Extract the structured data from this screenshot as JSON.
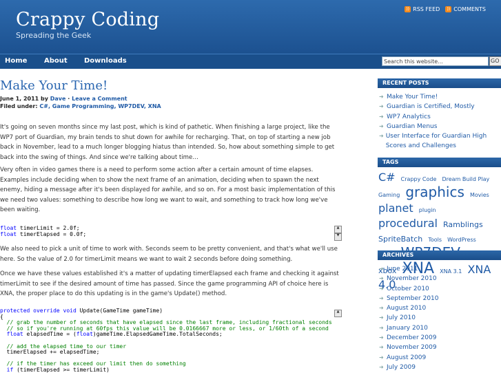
{
  "header": {
    "title": "Crappy Coding",
    "tagline": "Spreading the Geek",
    "feeds": [
      {
        "label": "RSS FEED"
      },
      {
        "label": "COMMENTS"
      }
    ]
  },
  "nav": {
    "items": [
      "Home",
      "About",
      "Downloads"
    ],
    "search_placeholder": "Search this website...",
    "go_label": "GO"
  },
  "post": {
    "title": "Make Your Time!",
    "date_by": "June 1, 2011 by",
    "author": "Dave",
    "sep": "·",
    "comment_link": "Leave a Comment",
    "filed_label": "Filed under:",
    "categories": "C#, Game Programming, WP7DEV, XNA",
    "para1": "It's going on seven months since my last post, which is kind of pathetic. When finishing a large project, like the WP7 port of Guardian, my brain tends to shut down for awhile for recharging. That, on top of starting a new job back in November, lead to a much longer blogging hiatus than intended. So, how about something simple to get back into the swing of things. And since we're talking about time…",
    "para2": "Very often in video games there is a need to perform some action after a certain amount of time elapses. Examples include deciding when to show the next frame of an animation, deciding when to spawn the next enemy, hiding a message after it's been displayed for awhile, and so on. For a most basic implementation of this we need two values: something to describe how long we want to wait, and something to track how long we've been waiting.",
    "para3": "We also need to pick a unit of time to work with. Seconds seem to be pretty convenient, and that's what we'll use here. So the value of 2.0 for timerLimit means we want to wait 2 seconds before doing something.",
    "para4": "Once we have these values established it's a matter of updating timerElapsed each frame and checking it against timerLimit to see if the desired amount of time has passed. Since the game programming API of choice here is XNA, the proper place to do this updating is in the game's Update() method."
  },
  "sidebar": {
    "recent_title": "RECENT POSTS",
    "recent": [
      "Make Your Time!",
      "Guardian is Certified, Mostly",
      "WP7 Analytics",
      "Guardian Menus",
      "User Interface for Guardian High Scores and Challenges"
    ],
    "tags_title": "TAGS",
    "tags": [
      {
        "t": "C#",
        "s": 2
      },
      {
        "t": "Crappy Code",
        "s": 0
      },
      {
        "t": "Dream Build Play",
        "s": 0
      },
      {
        "t": "Gaming",
        "s": 0
      },
      {
        "t": "graphics",
        "s": 3
      },
      {
        "t": "Movies",
        "s": 0
      },
      {
        "t": "planet",
        "s": 2
      },
      {
        "t": "plugin",
        "s": 0
      },
      {
        "t": "procedural",
        "s": 2
      },
      {
        "t": "Ramblings",
        "s": 1
      },
      {
        "t": "SpriteBatch",
        "s": 1
      },
      {
        "t": "Tools",
        "s": 0
      },
      {
        "t": "WordPress",
        "s": 0
      },
      {
        "t": "WP7",
        "s": 1
      },
      {
        "t": "WP7DEV",
        "s": 3
      },
      {
        "t": "XBLIG",
        "s": 0
      },
      {
        "t": "xbox",
        "s": 1
      },
      {
        "t": "XNA",
        "s": 4
      },
      {
        "t": "XNA 3.1",
        "s": 0
      },
      {
        "t": "XNA 4.0",
        "s": 2
      }
    ],
    "archives_title": "ARCHIVES",
    "archives": [
      "June 2011",
      "November 2010",
      "October 2010",
      "September 2010",
      "August 2010",
      "July 2010",
      "January 2010",
      "December 2009",
      "November 2009",
      "August 2009",
      "July 2009"
    ]
  }
}
